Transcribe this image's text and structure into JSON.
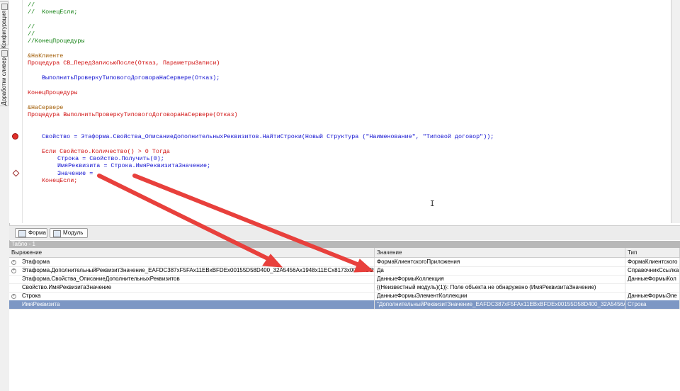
{
  "sidebar": {
    "tabs": [
      {
        "label": "Конфигурация",
        "icon": "configuration-icon"
      },
      {
        "label": "Доработки сливер",
        "icon": "document-icon"
      }
    ]
  },
  "code_lines": [
    {
      "text": "//"
    },
    {
      "text": "//  КонецЕсли;"
    },
    {
      "text": ""
    },
    {
      "text": "//"
    },
    {
      "text": "//"
    },
    {
      "text": "//КонецПроцедуры"
    },
    {
      "text": "&НаКлиенте"
    },
    {
      "text": "Процедура СВ_ПередЗаписьюПосле(Отказ, ПараметрыЗаписи)"
    },
    {
      "text": "ВыполнитьПроверкуТиповогоДоговораНаСервере(Отказ);"
    },
    {
      "text": "КонецПроцедуры"
    },
    {
      "text": "&НаСервере"
    },
    {
      "text": "Процедура ВыполнитьПроверкуТиповогоДоговораНаСервере(Отказ)"
    },
    {
      "text": "Свойство = Этаформа.Свойства_ОписаниеДополнительныхРеквизитов.НайтиСтроки(Новый Структура (\"Наименование\", \"Типовой договор\"));"
    },
    {
      "text": "Если Свойство.Количество() > 0 Тогда"
    },
    {
      "text": "Строка = Свойство.Получить(0);"
    },
    {
      "text": "ИмяРеквизита = Строка.ИмяРеквизитаЗначение;"
    },
    {
      "text": "Значение ="
    },
    {
      "text": "КонецЕсли;"
    }
  ],
  "bottom_tabs": [
    {
      "label": "Форма",
      "icon": "form-icon"
    },
    {
      "label": "Модуль",
      "icon": "module-icon"
    }
  ],
  "watch": {
    "title": "Табло - 1",
    "columns": [
      "Выражение",
      "Значение",
      "Тип"
    ],
    "rows": [
      {
        "expr": "Этаформа",
        "value": "ФормаКлиентскогоПриложения",
        "type": "ФормаКлиентского",
        "expandable": true,
        "selected": false
      },
      {
        "expr": "Этаформа.ДополнительныйРеквизитЗначение_EAFDC387xF5FAx11EBxBFDEx00155D58D400_32A5456Ax1948x11ECx8173x00155DB9D319",
        "value": "Да",
        "type": "СправочникСсылка",
        "expandable": true,
        "selected": false
      },
      {
        "expr": "Этаформа.Свойства_ОписаниеДополнительныхРеквизитов",
        "value": "ДанныеФормыКоллекция",
        "type": "ДанныеФормыКол",
        "expandable": false,
        "selected": false
      },
      {
        "expr": "Свойство.ИмяРеквизитаЗначение",
        "value": "{(Неизвестный модуль)(1)}: Поле объекта не обнаружено (ИмяРеквизитаЗначение)",
        "type": "",
        "expandable": false,
        "selected": false
      },
      {
        "expr": "Строка",
        "value": "ДанныеФормыЭлементКоллекции",
        "type": "ДанныеФормыЭле",
        "expandable": true,
        "selected": false
      },
      {
        "expr": "ИмяРеквизита",
        "value": "\"ДополнительныйРеквизитЗначение_EAFDC387xF5FAx11EBxBFDEx00155D58D400_32A5456Ax1948x11E...",
        "type": "Строка",
        "expandable": false,
        "selected": true
      }
    ]
  },
  "colors": {
    "comment": "#0f7f0f",
    "preprocessor": "#a05a00",
    "keyword": "#d01010",
    "identifier": "#1010d0",
    "selected_row": "#7d97c4",
    "annotation_arrow": "#e8403c"
  }
}
